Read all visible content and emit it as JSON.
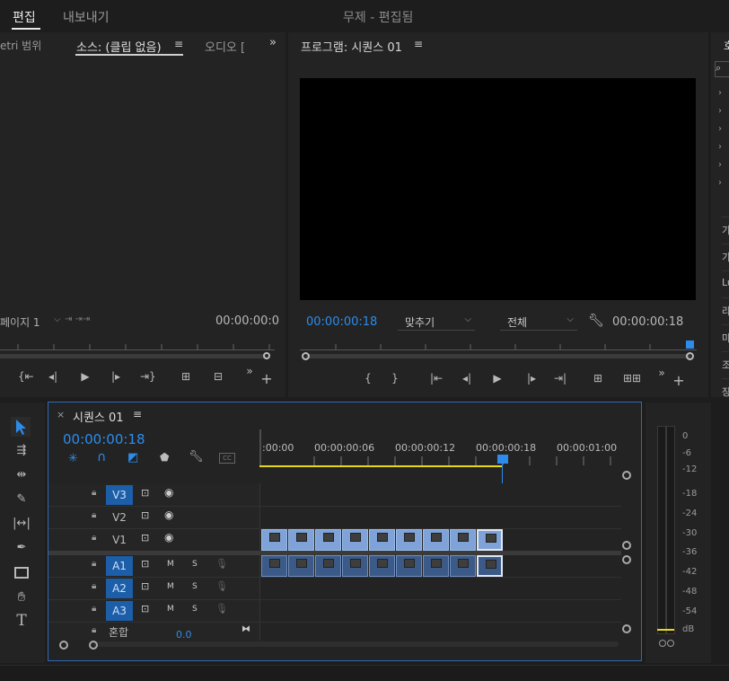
{
  "topbar": {
    "tabs": [
      "편집",
      "내보내기"
    ],
    "active_tab": "편집",
    "title": "무제 - 편집됨"
  },
  "source_panel": {
    "tabs": [
      "etri 범위",
      "소스: (클립 없음)",
      "오디오 ["
    ],
    "active_tab": "소스: (클립 없음)",
    "page_select": "페이지 1",
    "timecode": "00:00:00:0"
  },
  "program_panel": {
    "title": "프로그램: 시퀀스 01",
    "timecode": "00:00:00:18",
    "fit_select": "맞추기",
    "quality_select": "전체",
    "duration": "00:00:00:18"
  },
  "right_panel": {
    "header": "호",
    "items": [
      "가",
      "가",
      "Lu",
      "라",
      "마",
      "조",
      "장"
    ]
  },
  "timeline": {
    "tab": "시퀀스 01",
    "timecode": "00:00:00:18",
    "ruler_labels": [
      ":00:00",
      "00:00:00:06",
      "00:00:00:12",
      "00:00:00:18",
      "00:00:01:00"
    ],
    "video_tracks": [
      "V3",
      "V2",
      "V1"
    ],
    "audio_tracks": [
      "A1",
      "A2",
      "A3"
    ],
    "mix_label": "혼합",
    "mix_value": "0.0",
    "mute_label": "M",
    "solo_label": "S",
    "clip_count": 9
  },
  "meter": {
    "labels": [
      "0",
      "-6",
      "-12",
      "-18",
      "-24",
      "-30",
      "-36",
      "-42",
      "-48",
      "-54",
      "dB"
    ]
  },
  "tools": [
    "selection",
    "track-select",
    "ripple-edit",
    "razor",
    "slip",
    "pen",
    "rectangle",
    "hand",
    "type"
  ],
  "colors": {
    "accent": "#2d8ceb",
    "clip_video": "#7fa3d8",
    "clip_audio": "#3c5a87",
    "workarea": "#e8d81c",
    "panel_border": "#2d6bb8"
  }
}
